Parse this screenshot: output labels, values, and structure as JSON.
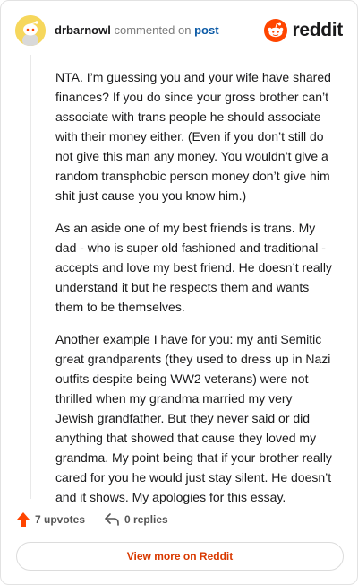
{
  "header": {
    "author": "drbarnowl",
    "commented_text": "commented on",
    "post_link": "post",
    "brand": "reddit"
  },
  "comment": {
    "paragraphs": [
      "NTA. I’m guessing you and your wife have shared finances? If you do since your gross brother can’t associate with trans people he should associate with their money either. (Even if you don’t still do not give this man any money. You wouldn’t give a random transphobic person money don’t give him shit just cause you you know him.)",
      "As an aside one of my best friends is trans. My dad - who is super old fashioned and traditional - accepts and love my best friend. He doesn’t really understand it but he respects them and wants them to be themselves.",
      "Another example I have for you: my anti Semitic great grandparents (they used to dress up in Nazi outfits despite being WW2 veterans) were not thrilled when my grandma married my very Jewish grandfather. But they never said or did anything that showed that cause they loved my grandma. My point being that if your brother really cared for you he would just stay silent. He doesn’t and it shows. My apologies for this essay."
    ]
  },
  "actions": {
    "upvotes": "7 upvotes",
    "replies": "0 replies"
  },
  "footer": {
    "view_more": "View more on Reddit"
  },
  "colors": {
    "brand_orange": "#ff4500",
    "link_blue": "#0b5aa6",
    "cta_orange": "#d93900"
  },
  "icons": {
    "avatar": "snoo-avatar",
    "logo": "reddit-logo-icon",
    "upvote": "upvote-arrow-icon",
    "reply": "reply-arrow-icon"
  }
}
